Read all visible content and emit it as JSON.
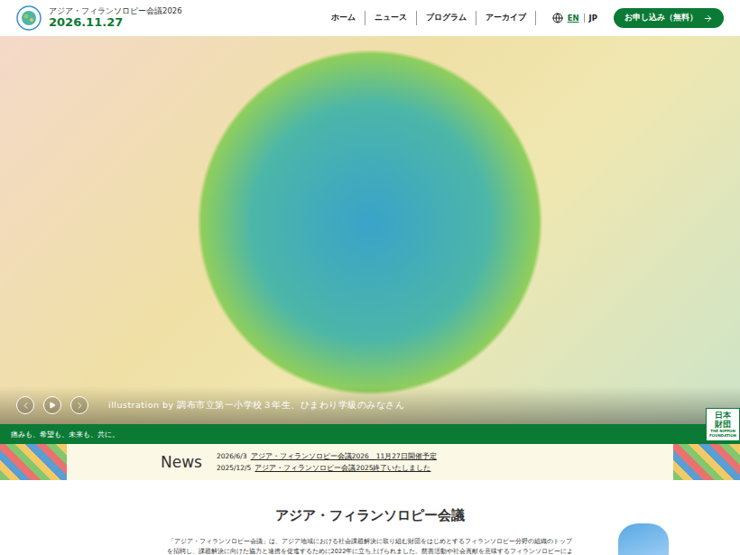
{
  "header": {
    "site_title": "アジア・フィランソロピー会議2026",
    "date": "2026.11.27",
    "nav": [
      {
        "label": "ホーム"
      },
      {
        "label": "ニュース"
      },
      {
        "label": "プログラム"
      },
      {
        "label": "アーカイブ"
      }
    ],
    "languages": [
      {
        "label": "EN",
        "selected": true
      },
      {
        "label": "JP",
        "selected": false
      }
    ],
    "cta": "お申し込み（無料）"
  },
  "hero": {
    "caption": "illustration by 調布市立第一小学校３年生、ひまわり学級のみなさん",
    "tagline": "痛みも、希望も、未来も、共に。"
  },
  "badge": {
    "name_ja": "日本財団",
    "name_en": "THE NIPPON FOUNDATION"
  },
  "news": {
    "heading": "News",
    "items": [
      {
        "date": "2026/6/3",
        "title": "アジア・フィランソロピー会議2026　11月27日開催予定"
      },
      {
        "date": "2025/12/5",
        "title": "アジア・フィランソロピー会議2025終了いたしました"
      }
    ]
  },
  "about": {
    "heading": "アジア・フィランソロピー会議",
    "lines": [
      "「アジア・フィランソロピー会議」は、アジア地域における社会課題解決に取り組む財団をはじめとするフィランソロピー分野の組織のトップ",
      "を招聘し、課題解決に向けた協力と連携を促進するために2022年に立ち上げられました。慈善活動や社会貢献を意味するフィランソロピーによ"
    ]
  }
}
